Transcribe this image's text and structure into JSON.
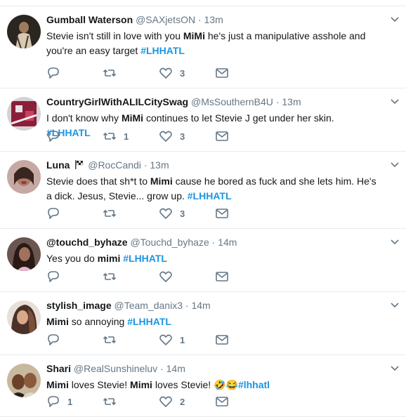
{
  "tweets": [
    {
      "fullname": "Gumball Waterson",
      "handle": "@SAXjetsON",
      "separator": "·",
      "time": "13m",
      "segments": [
        {
          "t": "Stevie isn't still in love with you "
        },
        {
          "b": "MiMi"
        },
        {
          "t": " he's just a manipulative asshole and you're an easy target "
        },
        {
          "h": "#LHHATL"
        }
      ],
      "replies": "",
      "retweets": "",
      "likes": "3"
    },
    {
      "fullname": "CountryGirlWithALILCitySwag",
      "handle": "@MsSouthernB4U",
      "separator": "·",
      "time": "13m",
      "segments": [
        {
          "t": "I don't know why "
        },
        {
          "b": "MiMi"
        },
        {
          "t": " continues to let Stevie J get under her skin. "
        },
        {
          "h": "#LHHATL"
        }
      ],
      "replies": "",
      "retweets": "1",
      "likes": "3"
    },
    {
      "fullname": "Luna",
      "handle": "@RocCandi",
      "separator": "·",
      "time": "13m",
      "segments": [
        {
          "t": "Stevie does that sh*t to "
        },
        {
          "b": "Mimi"
        },
        {
          "t": " cause he bored as fuck and she lets him. He's a dick. Jesus, Stevie... grow up. "
        },
        {
          "h": "#LHHATL"
        }
      ],
      "replies": "",
      "retweets": "",
      "likes": "3"
    },
    {
      "fullname": "@touchd_byhaze",
      "handle": "@Touchd_byhaze",
      "separator": "·",
      "time": "14m",
      "segments": [
        {
          "t": "Yes you do "
        },
        {
          "b": "mimi"
        },
        {
          "t": " "
        },
        {
          "h": "#LHHATL"
        }
      ],
      "replies": "",
      "retweets": "",
      "likes": ""
    },
    {
      "fullname": "stylish_image",
      "handle": "@Team_danix3",
      "separator": "·",
      "time": "14m",
      "segments": [
        {
          "b": "Mimi"
        },
        {
          "t": " so annoying "
        },
        {
          "h": "#LHHATL"
        }
      ],
      "replies": "",
      "retweets": "",
      "likes": "1"
    },
    {
      "fullname": "Shari",
      "handle": "@RealSunshineluv",
      "separator": "·",
      "time": "14m",
      "segments": [
        {
          "b": "Mimi"
        },
        {
          "t": " loves Stevie! "
        },
        {
          "b": "Mimi"
        },
        {
          "t": " loves Stevie! 🤣😂"
        },
        {
          "h": "#lhhatl"
        }
      ],
      "replies": "1",
      "retweets": "",
      "likes": "2"
    }
  ],
  "icons": {
    "reply": "reply-icon",
    "retweet": "retweet-icon",
    "like": "heart-icon",
    "dm": "envelope-icon",
    "caret": "chevron-down-icon",
    "flag": "checkered-flag-icon"
  },
  "colors": {
    "hashtag": "#1b95e0",
    "muted": "#657786",
    "text": "#14171a",
    "divider": "#e6ecf0"
  }
}
